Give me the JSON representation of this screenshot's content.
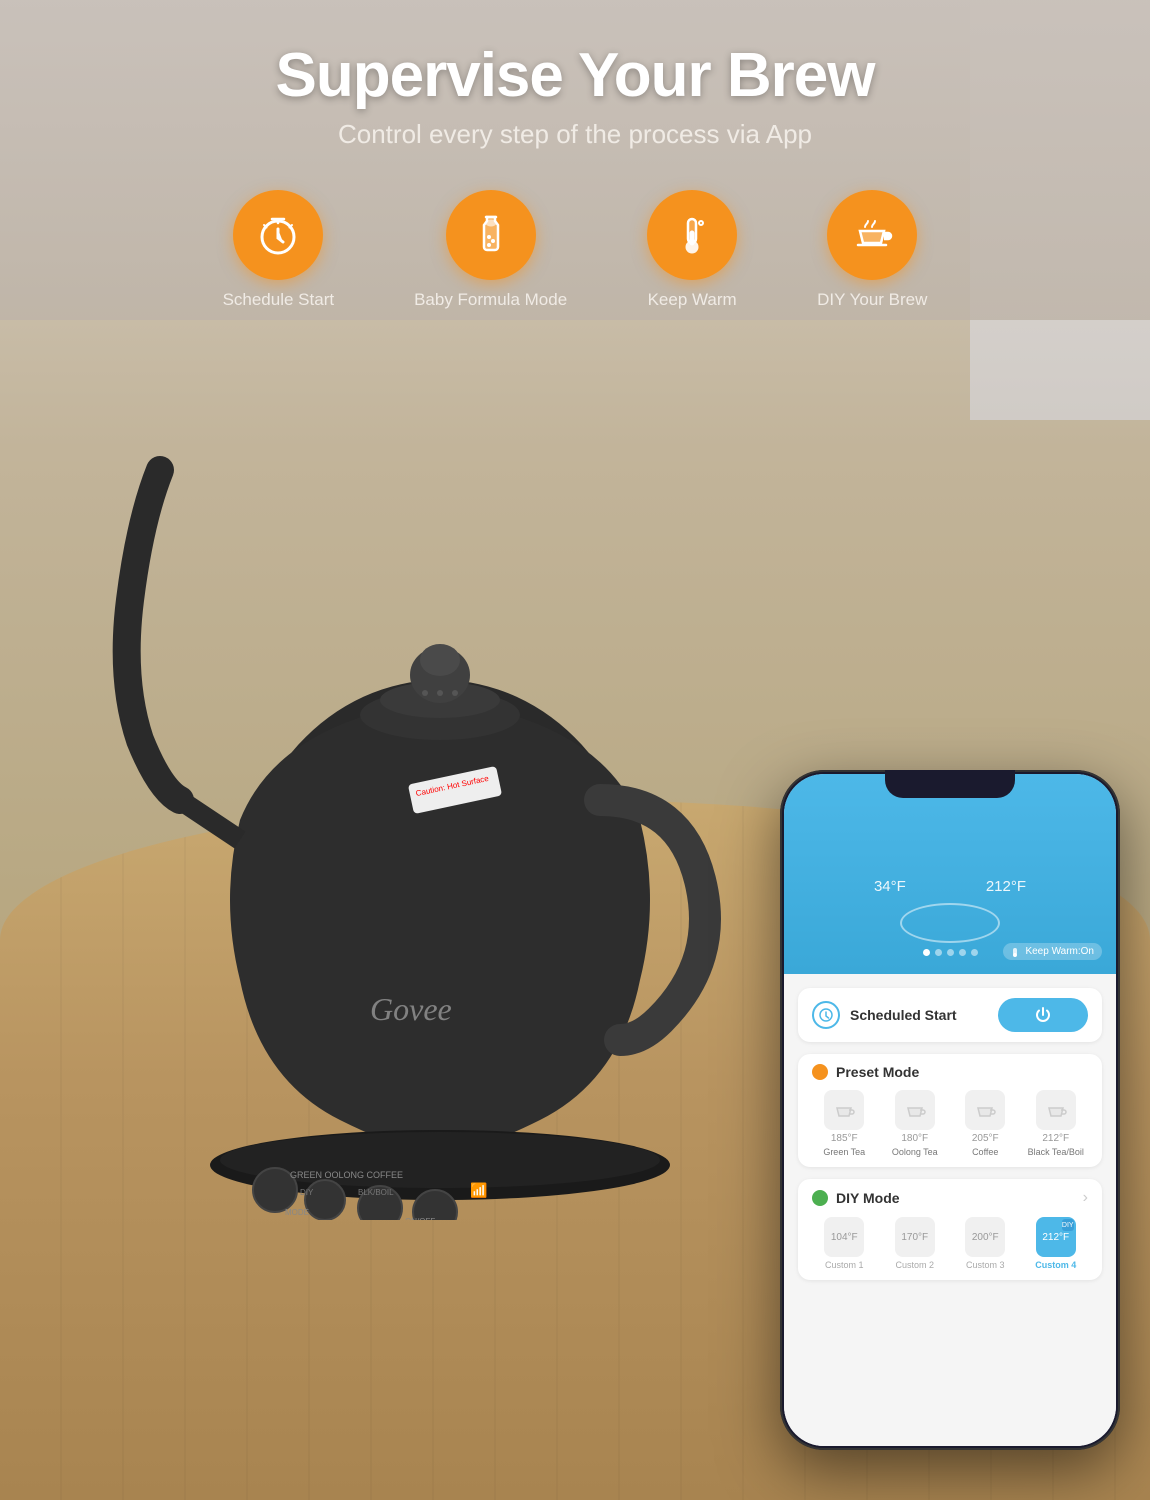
{
  "header": {
    "main_title": "Supervise Your Brew",
    "sub_title": "Control every step of the process via App"
  },
  "features": [
    {
      "id": "schedule-start",
      "label": "Schedule Start",
      "icon": "clock"
    },
    {
      "id": "baby-formula",
      "label": "Baby Formula Mode",
      "icon": "bottle"
    },
    {
      "id": "keep-warm",
      "label": "Keep Warm",
      "icon": "thermometer"
    },
    {
      "id": "diy-brew",
      "label": "DIY Your Brew",
      "icon": "cup"
    }
  ],
  "phone": {
    "temp_current": "34°F",
    "temp_target": "212°F",
    "keep_warm_label": "Keep Warm:On",
    "scheduled_start_label": "Scheduled Start",
    "preset_mode_label": "Preset Mode",
    "diy_mode_label": "DIY Mode",
    "presets": [
      {
        "temp": "185°F",
        "name": "Green Tea"
      },
      {
        "temp": "180°F",
        "name": "Oolong Tea"
      },
      {
        "temp": "205°F",
        "name": "Coffee"
      },
      {
        "temp": "212°F",
        "name": "Black Tea/Boil"
      }
    ],
    "diy_items": [
      {
        "temp": "104°F",
        "name": "Custom 1",
        "active": false
      },
      {
        "temp": "170°F",
        "name": "Custom 2",
        "active": false
      },
      {
        "temp": "200°F",
        "name": "Custom 3",
        "active": false
      },
      {
        "temp": "212°F",
        "name": "Custom 4",
        "active": true
      }
    ]
  },
  "brand": "Govee"
}
